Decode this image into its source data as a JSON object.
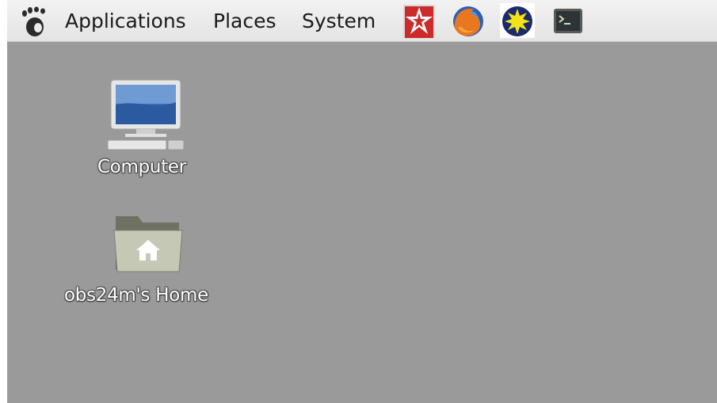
{
  "panel": {
    "menus": [
      {
        "label": "Applications"
      },
      {
        "label": "Places"
      },
      {
        "label": "System"
      }
    ],
    "launchers": [
      {
        "icon": "zagreb-launcher-icon"
      },
      {
        "icon": "firefox-icon"
      },
      {
        "icon": "ds9-icon"
      },
      {
        "icon": "terminal-icon"
      }
    ]
  },
  "desktop": {
    "background": "#9a9a9a",
    "icons": [
      {
        "label": "Computer",
        "icon": "computer-icon"
      },
      {
        "label": "obs24m's Home",
        "icon": "home-folder-icon"
      }
    ]
  }
}
